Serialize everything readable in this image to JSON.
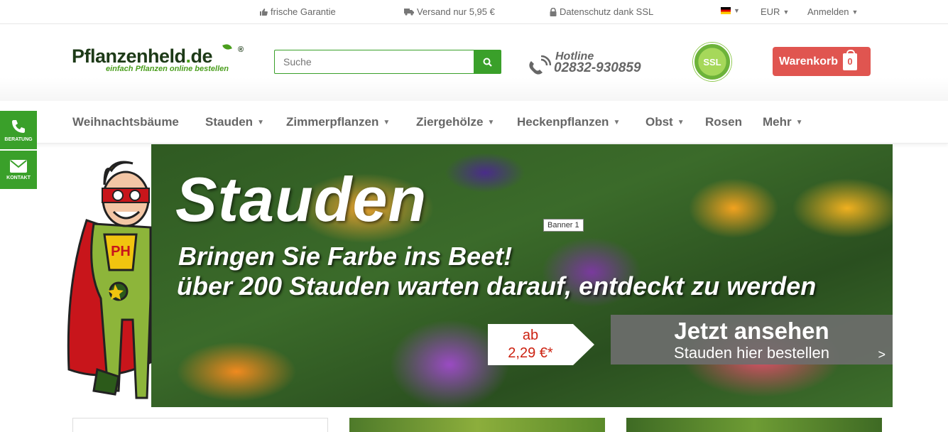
{
  "topbar": {
    "guarantee": "frische Garantie",
    "shipping": "Versand nur 5,95 €",
    "privacy": "Datenschutz dank SSL",
    "currency": "EUR",
    "login": "Anmelden"
  },
  "header": {
    "logo_brand": "Pflanzenheld",
    "logo_dot": ".",
    "logo_tld": "de",
    "logo_reg": "®",
    "logo_tagline": "einfach Pflanzen online bestellen",
    "search_placeholder": "Suche",
    "hotline_label": "Hotline",
    "hotline_number": "02832-930859",
    "ssl_badge": "SSL",
    "cart_label": "Warenkorb",
    "cart_count": "0"
  },
  "nav": {
    "items": [
      {
        "label": "Weihnachtsbäume"
      },
      {
        "label": "Stauden"
      },
      {
        "label": "Zimmerpflanzen"
      },
      {
        "label": "Ziergehölze"
      },
      {
        "label": "Heckenpflanzen"
      },
      {
        "label": "Obst"
      },
      {
        "label": "Rosen"
      },
      {
        "label": "Mehr"
      }
    ]
  },
  "side": {
    "consult": "BERATUNG",
    "contact": "KONTAKT"
  },
  "banner": {
    "title": "Stauden",
    "line1": "Bringen Sie Farbe ins Beet!",
    "line2": "über 200 Stauden warten darauf, entdeckt zu werden",
    "tooltip": "Banner 1",
    "price_prefix": "ab",
    "price": "2,29 €*",
    "cta_title": "Jetzt ansehen",
    "cta_sub": "Stauden hier bestellen",
    "cta_arrow": ">"
  },
  "colors": {
    "green": "#3aa02a",
    "cart_red": "#e05550",
    "logo_dark": "#1d3a17"
  }
}
